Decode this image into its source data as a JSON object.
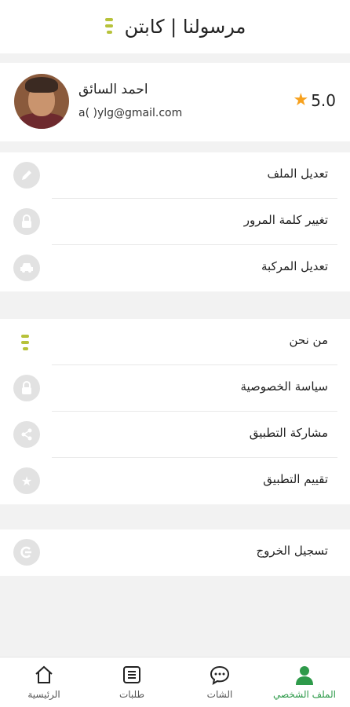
{
  "header": {
    "title": "مرسولنا | كابتن",
    "logo_icon": "brand-logo-mark"
  },
  "profile": {
    "name": "احمد السائق",
    "email": "a(   )ylg@gmail.com",
    "rating": "5.0",
    "rating_icon": "star-icon"
  },
  "menu_section_1": [
    {
      "label": "تعديل الملف",
      "icon": "pencil-icon"
    },
    {
      "label": "تغيير كلمة المرور",
      "icon": "lock-icon"
    },
    {
      "label": "تعديل المركبة",
      "icon": "car-icon"
    }
  ],
  "menu_section_2": [
    {
      "label": "من نحن",
      "icon": "brand-logo-mark"
    },
    {
      "label": "سياسة الخصوصية",
      "icon": "lock-icon"
    },
    {
      "label": "مشاركة التطبيق",
      "icon": "share-icon"
    },
    {
      "label": "تقييم التطبيق",
      "icon": "star-icon"
    }
  ],
  "menu_section_3": [
    {
      "label": "تسجيل الخروج",
      "icon": "logout-icon"
    }
  ],
  "bottom_nav": [
    {
      "label": "الرئيسية",
      "icon": "home-icon",
      "active": false
    },
    {
      "label": "طلبات",
      "icon": "list-icon",
      "active": false
    },
    {
      "label": "الشات",
      "icon": "chat-icon",
      "active": false
    },
    {
      "label": "الملف الشخصي",
      "icon": "profile-icon",
      "active": true
    }
  ],
  "colors": {
    "accent_green": "#2e9a4a",
    "star_orange": "#f7a11e",
    "logo_olive": "#b7c23a",
    "icon_gray": "#e2e2e2"
  }
}
